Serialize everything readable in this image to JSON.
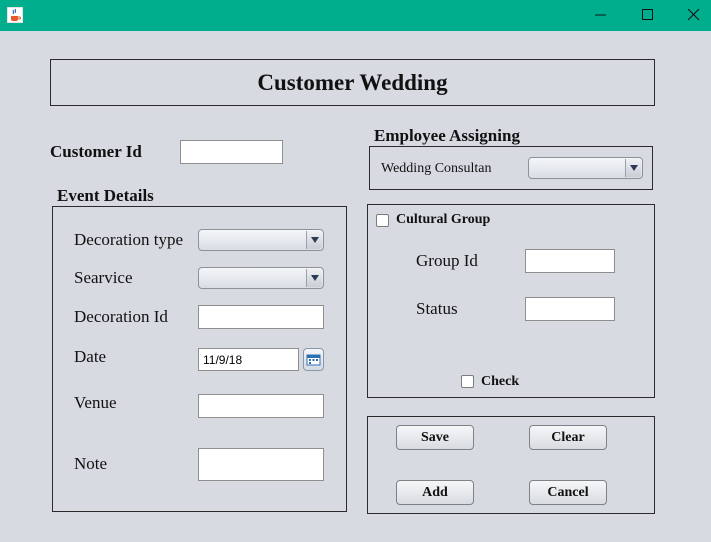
{
  "window": {
    "icon": "java-cup-icon",
    "controls": [
      "minimize-icon",
      "maximize-icon",
      "close-icon"
    ]
  },
  "header": {
    "title": "Customer Wedding"
  },
  "customer": {
    "label": "Customer Id",
    "value": ""
  },
  "employee": {
    "section_label": "Employee Assigning",
    "consultant_label": "Wedding Consultan",
    "consultant_value": ""
  },
  "event": {
    "section_label": "Event Details",
    "decoration_type_label": "Decoration type",
    "decoration_type_value": "",
    "service_label": "Searvice",
    "service_value": "",
    "decoration_id_label": "Decoration Id",
    "decoration_id_value": "",
    "date_label": "Date",
    "date_value": "11/9/18",
    "venue_label": "Venue",
    "venue_value": "",
    "note_label": "Note",
    "note_value": ""
  },
  "cultural": {
    "checkbox_label": "Cultural Group",
    "checked": false,
    "group_id_label": "Group Id",
    "group_id_value": "",
    "status_label": "Status",
    "status_value": "",
    "check_label": "Check",
    "check_checked": false
  },
  "actions": {
    "save": "Save",
    "clear": "Clear",
    "add": "Add",
    "cancel": "Cancel"
  },
  "colors": {
    "titlebar": "#00ae8e",
    "background": "#d7dae1"
  }
}
